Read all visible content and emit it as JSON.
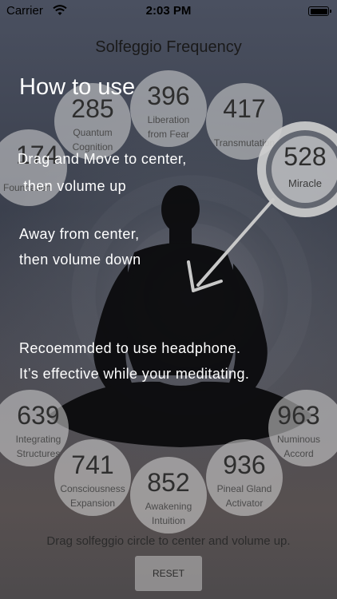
{
  "status_bar": {
    "carrier": "Carrier",
    "time": "2:03 PM",
    "wifi_icon": "wifi-icon",
    "battery_icon": "battery-icon"
  },
  "app": {
    "title": "Solfeggio Frequency"
  },
  "frequencies": [
    {
      "value": "285",
      "label_line1": "Quantum",
      "label_line2": "Cognition"
    },
    {
      "value": "396",
      "label_line1": "Liberation",
      "label_line2": "from Fear"
    },
    {
      "value": "417",
      "label_line1": "Transmutation",
      "label_line2": ""
    },
    {
      "value": "174",
      "label_line1": "Foundation",
      "label_line2": ""
    },
    {
      "value": "528",
      "label_line1": "Miracle",
      "label_line2": ""
    },
    {
      "value": "639",
      "label_line1": "Integrating",
      "label_line2": "Structures"
    },
    {
      "value": "741",
      "label_line1": "Consciousness",
      "label_line2": "Expansion"
    },
    {
      "value": "852",
      "label_line1": "Awakening",
      "label_line2": "Intuition"
    },
    {
      "value": "936",
      "label_line1": "Pineal Gland",
      "label_line2": "Activator"
    },
    {
      "value": "963",
      "label_line1": "Numinous",
      "label_line2": "Accord"
    }
  ],
  "tutorial": {
    "heading": "How to use",
    "line1": "Drag and Move to center,",
    "line2": " then volume up",
    "line3": "Away from center,",
    "line4": "then volume down",
    "line5": "Recoemmded to use headphone.",
    "line6": "It’s effective while your meditating."
  },
  "footer": {
    "hint": "Drag solfeggio circle to center and volume up.",
    "reset_label": "RESET"
  },
  "colors": {
    "overlay_text": "#ffffff",
    "circle_fill": "#d7d7d7",
    "background": "#3c4250"
  }
}
